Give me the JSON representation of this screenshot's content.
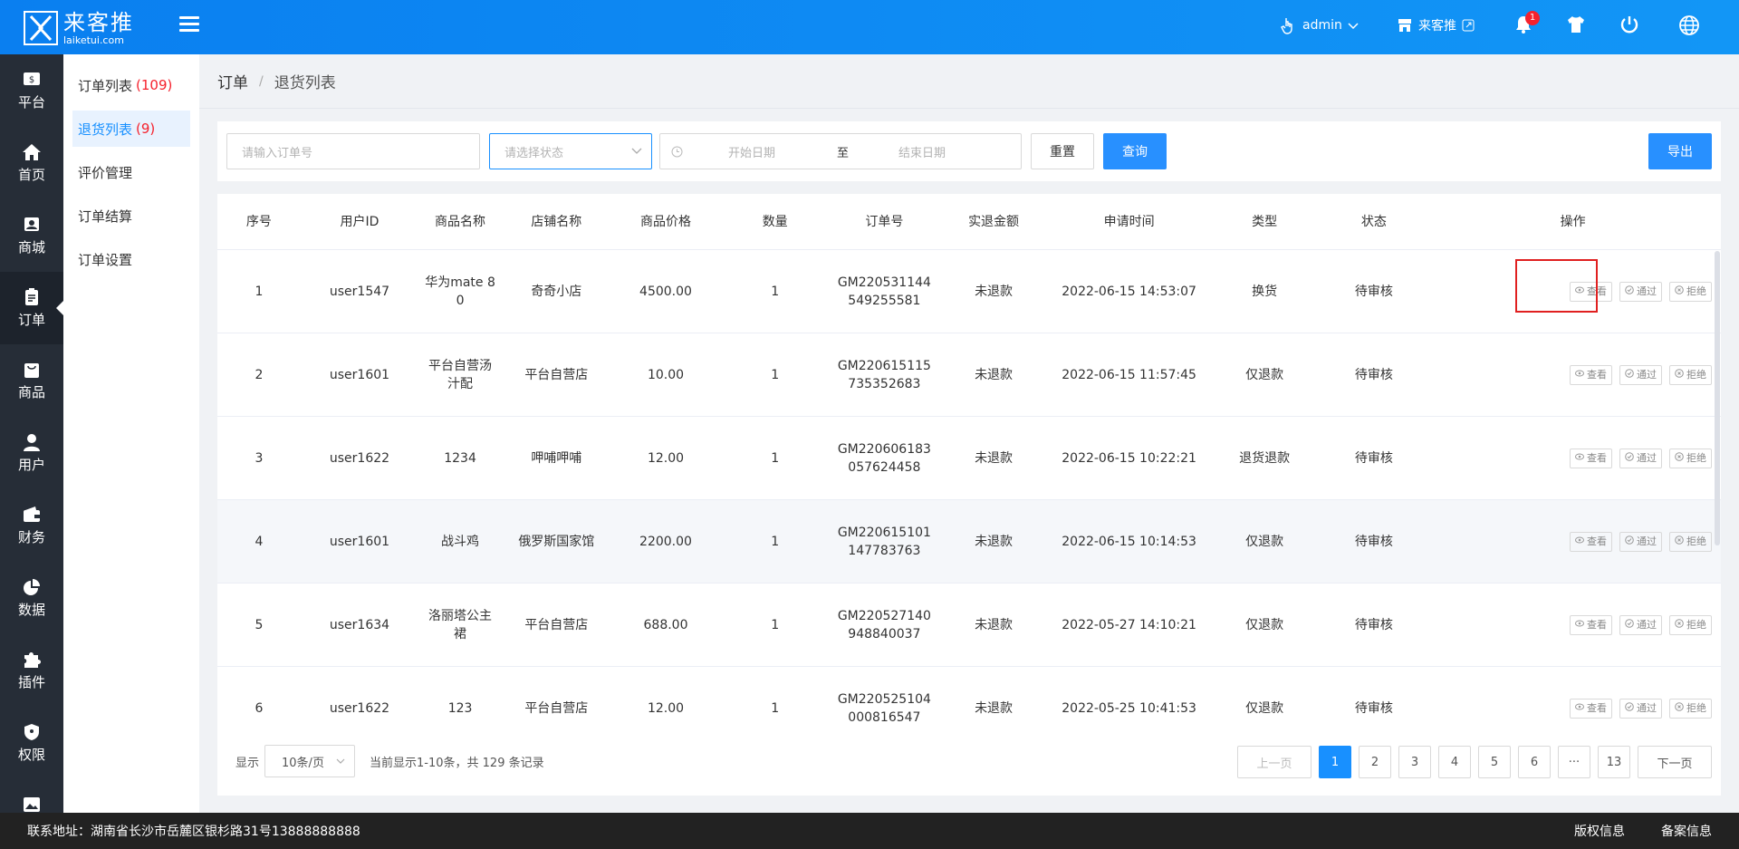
{
  "brand": {
    "name_cn": "来客推",
    "name_en": "laiketui.com"
  },
  "header": {
    "user": "admin",
    "shop": "来客推",
    "notifications": "1",
    "icons": [
      "hand-pointer-icon",
      "store-icon",
      "bell-icon",
      "shirt-icon",
      "power-icon",
      "globe-icon"
    ]
  },
  "sidebar": {
    "items": [
      {
        "label": "平台",
        "icon": "dollar-icon"
      },
      {
        "label": "首页",
        "icon": "home-icon"
      },
      {
        "label": "商城",
        "icon": "mall-icon"
      },
      {
        "label": "订单",
        "icon": "clipboard-icon",
        "active": true
      },
      {
        "label": "商品",
        "icon": "bag-icon"
      },
      {
        "label": "用户",
        "icon": "user-icon"
      },
      {
        "label": "财务",
        "icon": "wallet-icon"
      },
      {
        "label": "数据",
        "icon": "pie-chart-icon"
      },
      {
        "label": "插件",
        "icon": "puzzle-icon"
      },
      {
        "label": "权限",
        "icon": "shield-icon"
      }
    ]
  },
  "submenu": {
    "items": [
      {
        "label": "订单列表",
        "count": "(109)"
      },
      {
        "label": "退货列表",
        "count": "(9)"
      },
      {
        "label": "评价管理",
        "count": ""
      },
      {
        "label": "订单结算",
        "count": ""
      },
      {
        "label": "订单设置",
        "count": ""
      }
    ]
  },
  "breadcrumb": {
    "parent": "订单",
    "sep": "/",
    "current": "退货列表"
  },
  "filter": {
    "order_placeholder": "请输入订单号",
    "status_placeholder": "请选择状态",
    "start_placeholder": "开始日期",
    "to_label": "至",
    "end_placeholder": "结束日期",
    "reset_label": "重置",
    "query_label": "查询",
    "export_label": "导出"
  },
  "table": {
    "headers": [
      "序号",
      "用户ID",
      "商品名称",
      "店铺名称",
      "商品价格",
      "数量",
      "订单号",
      "实退金额",
      "申请时间",
      "类型",
      "状态",
      "操作"
    ],
    "op_labels": {
      "view": "查看",
      "approve": "通过",
      "reject": "拒绝"
    },
    "rows": [
      {
        "no": "1",
        "uid": "user1547",
        "name": "华为mate 80",
        "store": "奇奇小店",
        "price": "4500.00",
        "qty": "1",
        "order": "GM220531144549255581",
        "refund": "未退款",
        "time": "2022-06-15 14:53:07",
        "type": "换货",
        "status": "待审核"
      },
      {
        "no": "2",
        "uid": "user1601",
        "name": "平台自营汤汁配",
        "store": "平台自营店",
        "price": "10.00",
        "qty": "1",
        "order": "GM220615115735352683",
        "refund": "未退款",
        "time": "2022-06-15 11:57:45",
        "type": "仅退款",
        "status": "待审核"
      },
      {
        "no": "3",
        "uid": "user1622",
        "name": "1234",
        "store": "呷哺呷哺",
        "price": "12.00",
        "qty": "1",
        "order": "GM220606183057624458",
        "refund": "未退款",
        "time": "2022-06-15 10:22:21",
        "type": "退货退款",
        "status": "待审核"
      },
      {
        "no": "4",
        "uid": "user1601",
        "name": "战斗鸡",
        "store": "俄罗斯国家馆",
        "price": "2200.00",
        "qty": "1",
        "order": "GM220615101147783763",
        "refund": "未退款",
        "time": "2022-06-15 10:14:53",
        "type": "仅退款",
        "status": "待审核"
      },
      {
        "no": "5",
        "uid": "user1634",
        "name": "洛丽塔公主裙",
        "store": "平台自营店",
        "price": "688.00",
        "qty": "1",
        "order": "GM220527140948840037",
        "refund": "未退款",
        "time": "2022-05-27 14:10:21",
        "type": "仅退款",
        "status": "待审核"
      },
      {
        "no": "6",
        "uid": "user1622",
        "name": "123",
        "store": "平台自营店",
        "price": "12.00",
        "qty": "1",
        "order": "GM220525104000816547",
        "refund": "未退款",
        "time": "2022-05-25 10:41:53",
        "type": "仅退款",
        "status": "待审核"
      }
    ]
  },
  "pager": {
    "show_label": "显示",
    "page_size": "10条/页",
    "summary": "当前显示1-10条，共 129 条记录",
    "prev": "上一页",
    "next": "下一页",
    "pages": [
      "1",
      "2",
      "3",
      "4",
      "5",
      "6",
      "···",
      "13"
    ],
    "current": "1"
  },
  "footer": {
    "address": "联系地址：湖南省长沙市岳麓区银杉路31号13888888888",
    "copyright": "版权信息",
    "record": "备案信息"
  },
  "colors": {
    "primary": "#1890ff",
    "header": "#0a7ff0",
    "sidebar": "#262d37",
    "danger": "#f5222d"
  }
}
